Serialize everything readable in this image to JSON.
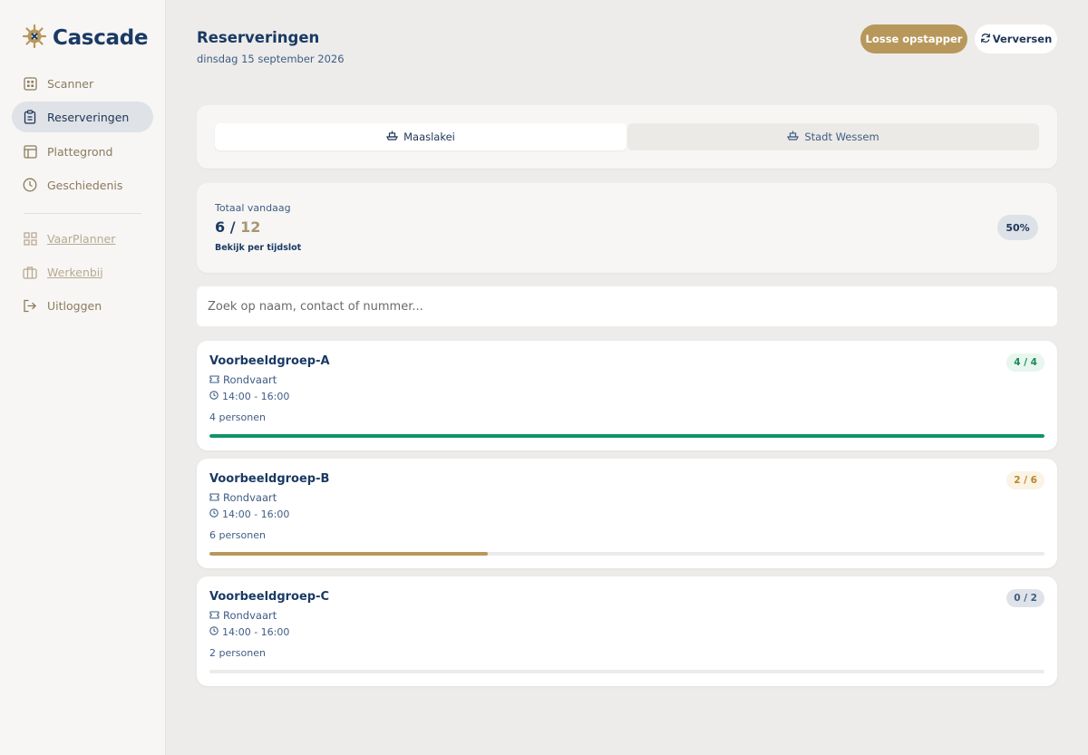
{
  "brand": {
    "name": "Cascade",
    "icon": "ships-wheel-icon"
  },
  "sidebar": {
    "items": [
      {
        "label": "Scanner",
        "icon": "grid-scan-icon",
        "active": false
      },
      {
        "label": "Reserveringen",
        "icon": "clipboard-icon",
        "active": true
      },
      {
        "label": "Plattegrond",
        "icon": "floorplan-icon",
        "active": false
      },
      {
        "label": "Geschiedenis",
        "icon": "clock-icon",
        "active": false
      },
      {
        "label": "VaarPlanner",
        "icon": "grid-icon",
        "active": false
      },
      {
        "label": "Werkenbij",
        "icon": "briefcase-icon",
        "active": false
      },
      {
        "label": "Uitloggen",
        "icon": "logout-icon",
        "active": false
      }
    ]
  },
  "header": {
    "title": "Reserveringen",
    "date": "dinsdag 15 september 2026",
    "losse_label": "Losse opstapper",
    "refresh_label": "Verversen"
  },
  "tabs": [
    {
      "label": "Maaslakei",
      "icon": "boat-icon",
      "active": true
    },
    {
      "label": "Stadt Wessem",
      "icon": "boat-icon",
      "active": false
    }
  ],
  "summary": {
    "label": "Totaal vandaag",
    "current": "6",
    "separator": "/",
    "max": "12",
    "link": "Bekijk per tijdslot",
    "percent": "50%"
  },
  "search": {
    "placeholder": "Zoek op naam, contact of nummer...",
    "value": ""
  },
  "reservations": [
    {
      "name": "Voorbeeldgroep-A",
      "type": "Rondvaart",
      "time": "14:00 - 16:00",
      "people": "4 personen",
      "badge": "4 / 4",
      "progress": 1.0,
      "status": "full",
      "color": "#109467"
    },
    {
      "name": "Voorbeeldgroep-B",
      "type": "Rondvaart",
      "time": "14:00 - 16:00",
      "people": "6 personen",
      "badge": "2 / 6",
      "progress": 0.3333,
      "status": "part",
      "color": "#b8975a"
    },
    {
      "name": "Voorbeeldgroep-C",
      "type": "Rondvaart",
      "time": "14:00 - 16:00",
      "people": "2 personen",
      "badge": "0 / 2",
      "progress": 0,
      "status": "none",
      "color": "#b8975a"
    }
  ],
  "colors": {
    "accent": "#b8975a",
    "navy": "#1a3a64",
    "success": "#109467"
  }
}
